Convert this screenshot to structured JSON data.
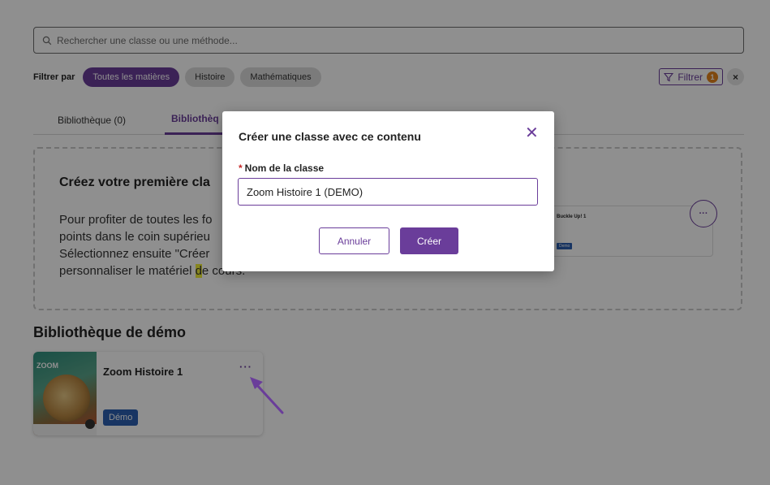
{
  "search": {
    "placeholder": "Rechercher une classe ou une méthode..."
  },
  "filters": {
    "label": "Filtrer par",
    "chips": [
      "Toutes les matières",
      "Histoire",
      "Mathématiques"
    ],
    "filter_button": "Filtrer",
    "filter_count": "1",
    "clear_label": "×"
  },
  "tabs": [
    "Bibliothèque (0)",
    "Bibliothèq"
  ],
  "empty_state": {
    "title": "Créez votre première cla",
    "lines": [
      "Pour profiter de toutes les fo",
      "points dans le coin supérieu",
      "Sélectionnez ensuite \"Créer",
      "personnaliser le matériel "
    ],
    "highlight": "d",
    "line_end": "e cours."
  },
  "mini_card": {
    "title": "Buckle Up! 1",
    "badge": "Demo",
    "more": "···"
  },
  "demo_section": {
    "title": "Bibliothèque de démo",
    "card": {
      "cover_text": "ZOOM",
      "title": "Zoom Histoire 1",
      "badge": "Démo",
      "menu": "···"
    }
  },
  "modal": {
    "title": "Créer une classe avec ce contenu",
    "close": "✕",
    "field_required": "*",
    "field_label": "Nom de la classe",
    "field_value": "Zoom Histoire 1 (DEMO)",
    "cancel": "Annuler",
    "create": "Créer"
  },
  "colors": {
    "accent": "#6a3d9a",
    "demo_badge": "#2b5fb0",
    "highlight": "#f1ef3a",
    "counter": "#e3831b"
  }
}
